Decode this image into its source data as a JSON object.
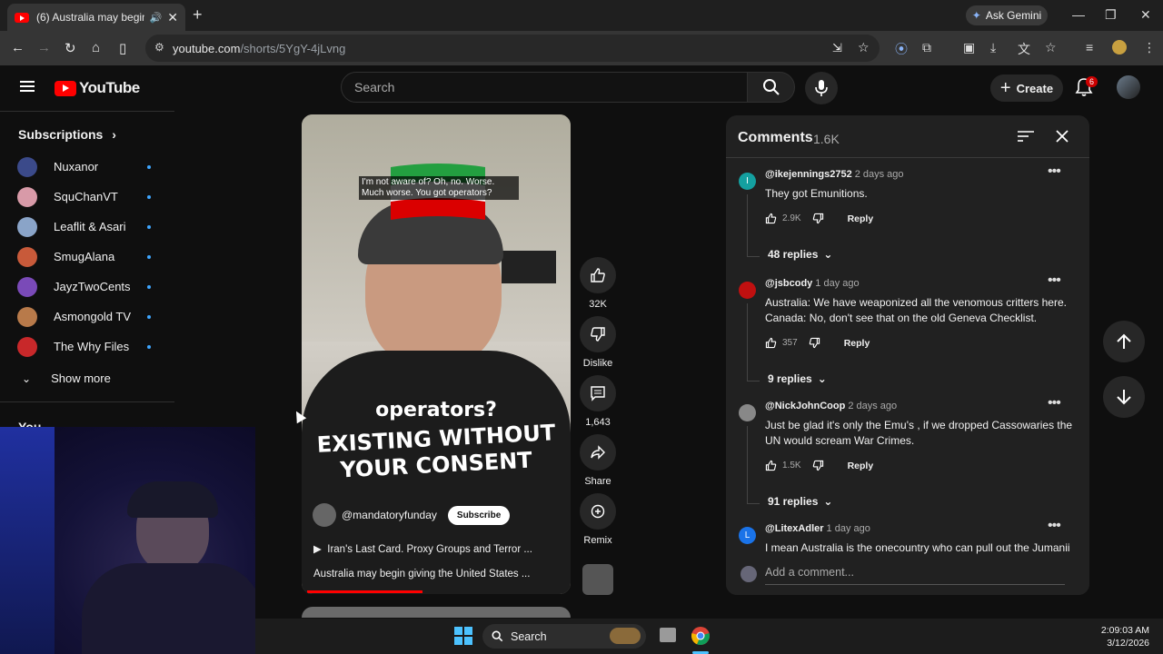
{
  "browser": {
    "tab_title": "(6) Australia may begin givi",
    "url_host": "youtube.com",
    "url_path": "/shorts/5YgY-4jLvng",
    "gemini_label": "Ask Gemini"
  },
  "yt": {
    "logo_text": "YouTube",
    "search_placeholder": "Search",
    "create_label": "Create",
    "notif_count": "6"
  },
  "sidebar": {
    "subs_heading": "Subscriptions",
    "items": [
      {
        "label": "Nuxanor",
        "color": "#3b4a8a"
      },
      {
        "label": "SquChanVT",
        "color": "#d89aa8"
      },
      {
        "label": "Leaflit & Asari",
        "color": "#8aa4c8"
      },
      {
        "label": "SmugAlana",
        "color": "#c85a3a"
      },
      {
        "label": "JayzTwoCents",
        "color": "#7a4ab8"
      },
      {
        "label": "Asmongold TV",
        "color": "#b87a4a"
      },
      {
        "label": "The Why Files",
        "color": "#c8282a"
      }
    ],
    "show_more": "Show more",
    "you_label": "You"
  },
  "video": {
    "caption": "I'm not aware of? Oh, no. Worse. Much worse. You got operators?",
    "shirt_line1": "operators?",
    "shirt_line2": "EXISTING WITHOUT",
    "shirt_line3": "YOUR CONSENT",
    "channel": "@mandatoryfunday",
    "subscribe": "Subscribe",
    "title": "Iran's Last Card. Proxy Groups and Terror ...",
    "description": "Australia may begin giving the United States ...",
    "progress": 0.43
  },
  "actions": {
    "likes": "32K",
    "dislike": "Dislike",
    "comments": "1,643",
    "share": "Share",
    "remix": "Remix"
  },
  "comments": {
    "title": "Comments",
    "count": "1.6K",
    "add_placeholder": "Add a comment...",
    "reply_label": "Reply",
    "items": [
      {
        "handle": "@ikejennings2752",
        "time": "2 days ago",
        "text": "They got Emunitions.",
        "likes": "2.9K",
        "replies": "48 replies",
        "avatar_letter": "I",
        "avatar_color": "#14a0a0"
      },
      {
        "handle": "@jsbcody",
        "time": "1 day ago",
        "text": "Australia: We have weaponized all the venomous critters here. Canada: No, don't see that on the old Geneva Checklist.",
        "likes": "357",
        "replies": "9 replies",
        "avatar_letter": "",
        "avatar_color": "#c01010"
      },
      {
        "handle": "@NickJohnCoop",
        "time": "2 days ago",
        "text": "Just be glad it's only the Emu's , if we dropped Cassowaries the UN would scream  War Crimes.",
        "likes": "1.5K",
        "replies": "91 replies",
        "avatar_letter": "",
        "avatar_color": "#888888"
      },
      {
        "handle": "@LitexAdler",
        "time": "1 day ago",
        "text": "I mean Australia is the onecountry who can pull out the Jumanii",
        "likes": "",
        "replies": "",
        "avatar_letter": "L",
        "avatar_color": "#1a73e8"
      }
    ]
  },
  "taskbar": {
    "search": "Search",
    "time": "2:09:03 AM",
    "date": "3/12/2026"
  }
}
